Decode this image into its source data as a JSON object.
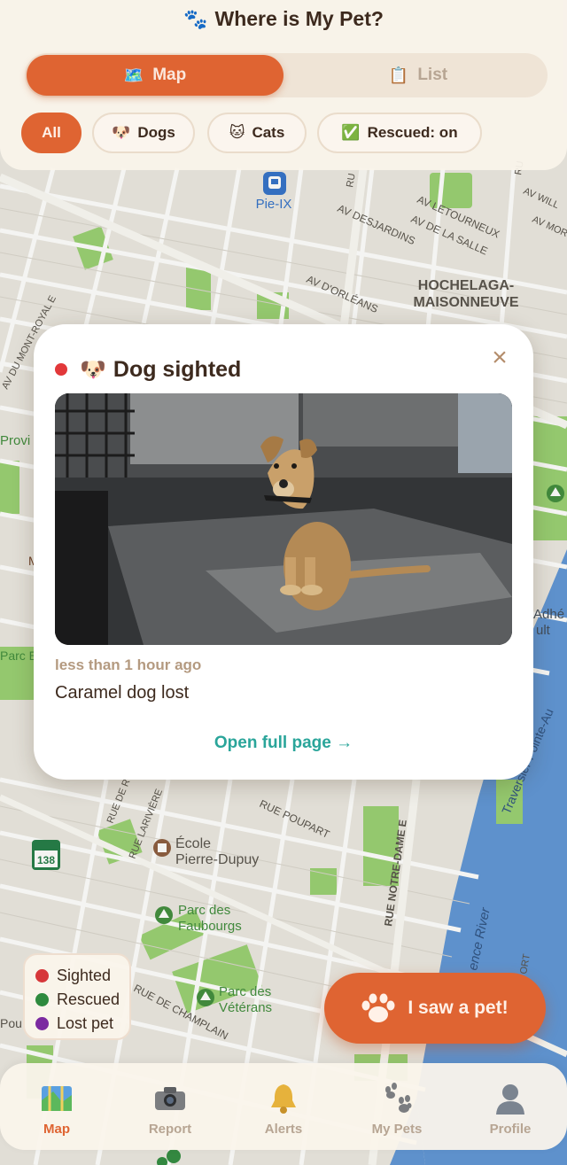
{
  "app": {
    "title": "Where is My Pet?"
  },
  "view_toggle": {
    "map_label": "Map",
    "list_label": "List",
    "selected": "Map"
  },
  "filters": {
    "all": "All",
    "dogs": "Dogs",
    "cats": "Cats",
    "rescued": "Rescued: on"
  },
  "map_labels": {
    "pie_ix": "Pie-IX",
    "hochelaga_1": "HOCHELAGA-",
    "hochelaga_2": "MAISONNEUVE",
    "av_desjardins": "AV DESJARDINS",
    "av_letourneux": "AV LETOURNEUX",
    "av_de_la_salle": "AV DE LA SALLE",
    "av_dorleans": "AV D'ORLÉANS",
    "av_will": "AV WILL",
    "av_mor": "AV MOR",
    "av_mont_royal": "AV DU MONT-ROYAL E",
    "provi": "Provi",
    "parc_e": "Parc E",
    "adhe": "Adhé",
    "ult": "ult",
    "rue_lariviere": "RUE LARIVIÈRE",
    "rue_de_r": "RUE DE R",
    "rue_poupart": "RUE POUPART",
    "rue_notre_dame": "RUE NOTRE-DAME E",
    "ecole_1": "École",
    "ecole_2": "Pierre-Dupuy",
    "parc_faubourgs_1": "Parc des",
    "parc_faubourgs_2": "Faubourgs",
    "parc_veterans_1": "Parc des",
    "parc_veterans_2": "Vétérans",
    "rue_champlain": "RUE DE CHAMPLAIN",
    "route_138": "138",
    "river": "ence River",
    "traversier": "Traversier Pointe-Au",
    "pou": "Pou",
    "rue_partial_1": "RU",
    "rue_partial_2": "RU",
    "ort": "ORT",
    "m_label": "M"
  },
  "popup": {
    "title": "Dog sighted",
    "status_color": "#e2383a",
    "time": "less than 1 hour ago",
    "description": "Caramel dog lost",
    "link": "Open full page →"
  },
  "legend": [
    {
      "label": "Sighted",
      "color": "#d6373a"
    },
    {
      "label": "Rescued",
      "color": "#2e8a3e"
    },
    {
      "label": "Lost pet",
      "color": "#7b2aa0"
    }
  ],
  "fab": {
    "label": "I saw a pet!"
  },
  "nav": {
    "map": "Map",
    "report": "Report",
    "alerts": "Alerts",
    "my_pets": "My Pets",
    "profile": "Profile",
    "active": "Map"
  },
  "colors": {
    "accent": "#df6432",
    "link": "#2aa59a",
    "park": "#8ccb6a",
    "water": "#5a8fd1",
    "text": "#3d2a1e"
  }
}
